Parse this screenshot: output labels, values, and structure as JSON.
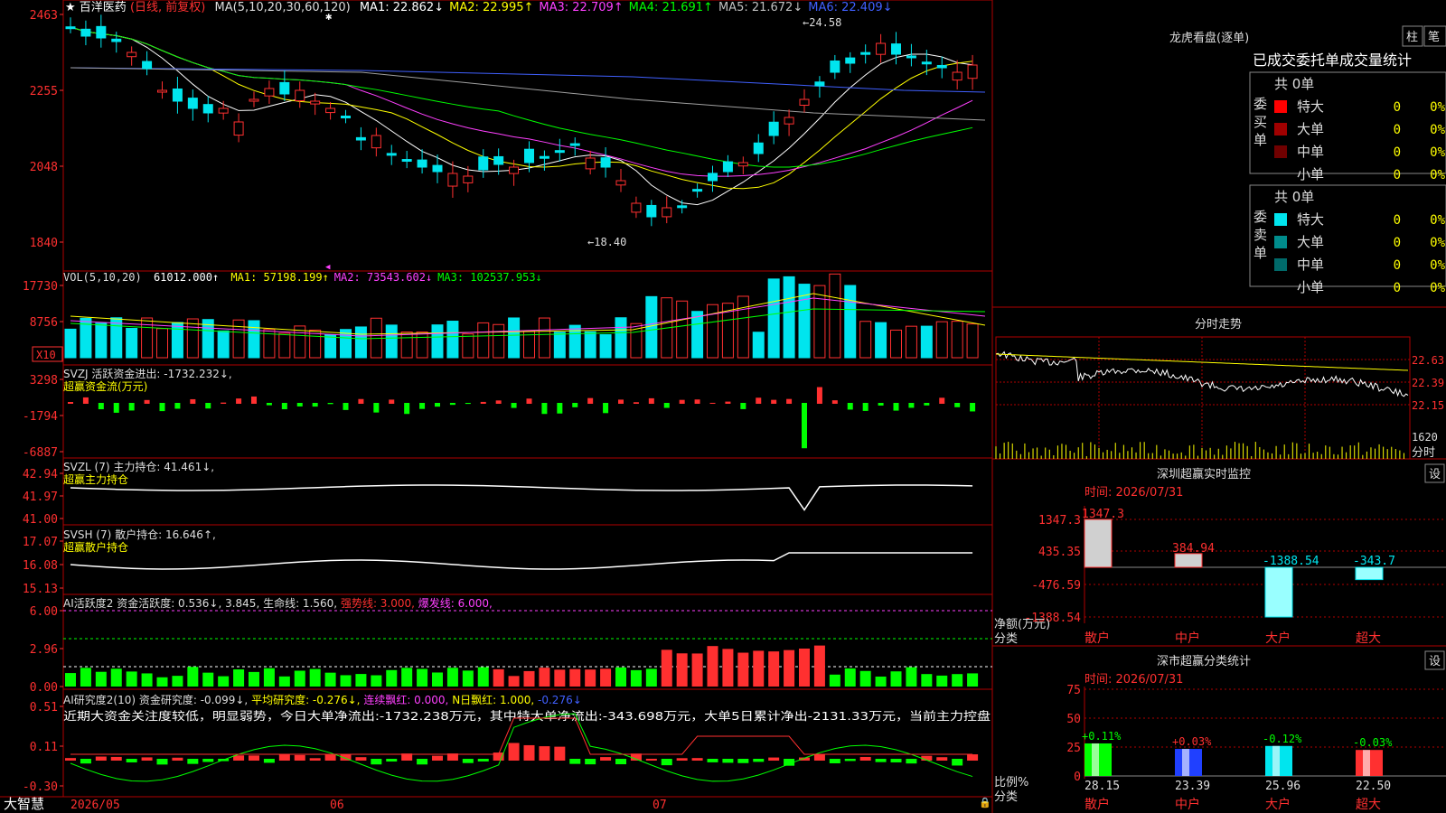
{
  "colors": {
    "up": "#ff3030",
    "down": "#00e5ee",
    "panel_border": "#b00000",
    "axis_text": "#ff3030",
    "white": "#ffffff",
    "yellow": "#ffff00",
    "magenta": "#ff40ff",
    "green": "#00ff00",
    "blue": "#4060ff",
    "gray": "#a0a0a0"
  },
  "price_panel": {
    "title_star": "★",
    "stock_name": "百洋医药",
    "mode": "(日线, 前复权)",
    "ma_label": "MA(5,10,20,30,60,120)",
    "ma_values": [
      {
        "label": "MA1: 22.862↓",
        "color": "#ffffff"
      },
      {
        "label": "MA2: 22.995↑",
        "color": "#ffff00"
      },
      {
        "label": "MA3: 22.709↑",
        "color": "#ff40ff"
      },
      {
        "label": "MA4: 21.691↑",
        "color": "#00ff00"
      },
      {
        "label": "MA5: 21.672↓",
        "color": "#c0c0c0"
      },
      {
        "label": "MA6: 22.409↓",
        "color": "#4060ff"
      }
    ],
    "yticks": [
      "2463",
      "2255",
      "2048",
      "1840"
    ],
    "high_label": "24.58",
    "low_label": "←18.40"
  },
  "vol_panel": {
    "label": "VOL(5,10,20)",
    "value": "61012.000↑",
    "ma_values": [
      {
        "label": "MA1: 57198.199↑",
        "color": "#ffff00"
      },
      {
        "label": "MA2: 73543.602↓",
        "color": "#ff40ff"
      },
      {
        "label": "MA3: 102537.953↓",
        "color": "#00ff00"
      }
    ],
    "yticks": [
      "17730",
      "8756"
    ],
    "unit": "X10"
  },
  "svzj_panel": {
    "label": "SVZJ  活跃资金进出: -1732.232↓,",
    "sub": "超赢资金流(万元)",
    "yticks": [
      "3298",
      "-1794",
      "-6887"
    ]
  },
  "svzl_panel": {
    "label": "SVZL (7) 主力持仓: 41.461↓,",
    "sub": "超赢主力持仓",
    "yticks": [
      "42.94",
      "41.97",
      "41.00"
    ]
  },
  "svsh_panel": {
    "label": "SVSH (7) 散户持仓: 16.646↑,",
    "sub": "超赢散户持仓",
    "yticks": [
      "17.07",
      "16.08",
      "15.13"
    ]
  },
  "ai_act_panel": {
    "label": "AI活跃度2 资金活跃度: 0.536↓, 3.845, 生命线: 1.560,",
    "strong": "强势线: 3.000,",
    "burst": "爆发线: 6.000,",
    "yticks": [
      "6.00",
      "2.96",
      "0.00"
    ]
  },
  "ai_res_panel": {
    "label": "AI研究度2(10) 资金研究度: -0.099↓,",
    "avg": "平均研究度: -0.276↓,",
    "cont": "连续飘红: 0.000,",
    "nday": "N日飘红: 1.000,",
    "last": "-0.276↓",
    "comment": "近期大资金关注度较低，明显弱势，今日大单净流出:-1732.238万元，其中特大单净流出:-343.698万元，大单5日累计净出-2131.33万元，当前主力控盘",
    "yticks": [
      "0.51",
      "0.11",
      "-0.30"
    ]
  },
  "bottom_bar": {
    "brand": "大智慧",
    "dates": [
      "2026/05",
      "06",
      "07"
    ]
  },
  "right": {
    "lhb_title": "龙虎看盘(逐单)",
    "btn_zhu": "柱",
    "btn_bi": "笔",
    "stats_title": "已成交委托单成交量统计",
    "buy_side": "委买单",
    "sell_side": "委卖单",
    "buy_total": "共 0单",
    "sell_total": "共 0单",
    "buy_rows": [
      {
        "name": "特大",
        "count": "0",
        "pct": "0%",
        "color": "#ff0000"
      },
      {
        "name": "大单",
        "count": "0",
        "pct": "0%",
        "color": "#a00000"
      },
      {
        "name": "中单",
        "count": "0",
        "pct": "0%",
        "color": "#700000"
      },
      {
        "name": "小单",
        "count": "0",
        "pct": "0%",
        "color": ""
      }
    ],
    "sell_rows": [
      {
        "name": "特大",
        "count": "0",
        "pct": "0%",
        "color": "#00e5ee"
      },
      {
        "name": "大单",
        "count": "0",
        "pct": "0%",
        "color": "#008c8c"
      },
      {
        "name": "中单",
        "count": "0",
        "pct": "0%",
        "color": "#006a6a"
      },
      {
        "name": "小单",
        "count": "0",
        "pct": "0%",
        "color": ""
      }
    ],
    "intraday_title": "分时走势",
    "intraday_prices": [
      "22.63",
      "22.39",
      "22.15"
    ],
    "intraday_vol": "1620",
    "intraday_tag": "分时",
    "monitor_title": "深圳超赢实时监控",
    "monitor_set": "设",
    "monitor_time": "时间: 2026/07/31",
    "monitor_yticks": [
      "1347.3",
      "435.35",
      "-476.59",
      "-1388.54"
    ],
    "monitor_ylabel": "净额(万元)",
    "monitor_xlabel": "分类",
    "monitor_bars": [
      {
        "cat": "散户",
        "value": 1347.3,
        "label": "1347.3"
      },
      {
        "cat": "中户",
        "value": 384.94,
        "label": "384.94"
      },
      {
        "cat": "大户",
        "value": -1388.54,
        "label": "-1388.54"
      },
      {
        "cat": "超大",
        "value": -343.7,
        "label": "-343.7"
      }
    ],
    "classify_title": "深市超赢分类统计",
    "classify_set": "设",
    "classify_time": "时间: 2026/07/31",
    "classify_yticks": [
      "75",
      "50",
      "25",
      "0"
    ],
    "classify_ylabel": "比例%",
    "classify_xlabel": "分类",
    "classify_bars": [
      {
        "cat": "散户",
        "value": 28.15,
        "delta": "+0.11%",
        "color": "#00ff00",
        "dcolor": "#00ff00"
      },
      {
        "cat": "中户",
        "value": 23.39,
        "delta": "+0.03%",
        "color": "#2040ff",
        "dcolor": "#ff3030"
      },
      {
        "cat": "大户",
        "value": 25.96,
        "delta": "-0.12%",
        "color": "#00e5ee",
        "dcolor": "#00ff00"
      },
      {
        "cat": "超大",
        "value": 22.5,
        "delta": "-0.03%",
        "color": "#ff3030",
        "dcolor": "#00ff00"
      }
    ]
  }
}
